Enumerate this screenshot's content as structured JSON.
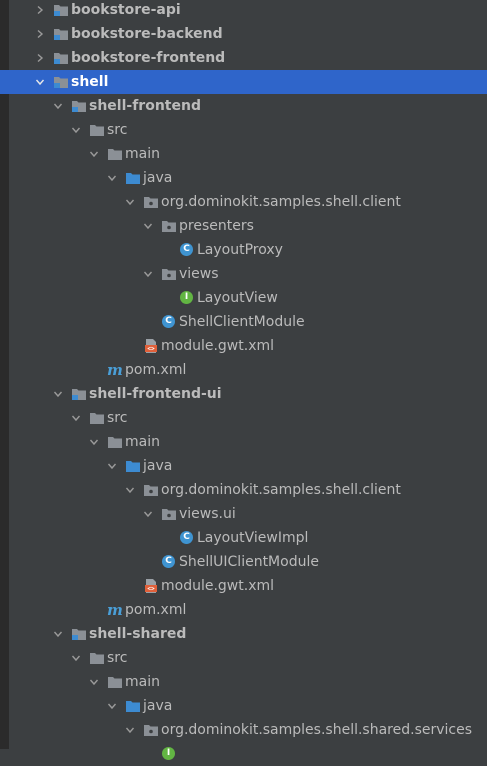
{
  "colors": {
    "background": "#3c3f41",
    "selection": "#2f65ca",
    "folder": "#8b9096",
    "source_folder": "#3d8bd1",
    "class_icon": "#3f94d1",
    "interface_icon": "#62b543",
    "maven": "#4a9fd8"
  },
  "tree": [
    {
      "label": "bookstore-api",
      "depth": 0,
      "arrow": "right",
      "icon": "module-folder-icon",
      "bold": true,
      "selected": false
    },
    {
      "label": "bookstore-backend",
      "depth": 0,
      "arrow": "right",
      "icon": "module-folder-icon",
      "bold": true,
      "selected": false
    },
    {
      "label": "bookstore-frontend",
      "depth": 0,
      "arrow": "right",
      "icon": "module-folder-icon",
      "bold": true,
      "selected": false
    },
    {
      "label": "shell",
      "depth": 0,
      "arrow": "down",
      "icon": "module-folder-icon",
      "bold": true,
      "selected": true
    },
    {
      "label": "shell-frontend",
      "depth": 1,
      "arrow": "down",
      "icon": "module-folder-icon",
      "bold": true,
      "selected": false
    },
    {
      "label": "src",
      "depth": 2,
      "arrow": "down",
      "icon": "folder-icon",
      "bold": false,
      "selected": false
    },
    {
      "label": "main",
      "depth": 3,
      "arrow": "down",
      "icon": "folder-icon",
      "bold": false,
      "selected": false
    },
    {
      "label": "java",
      "depth": 4,
      "arrow": "down",
      "icon": "source-folder-icon",
      "bold": false,
      "selected": false
    },
    {
      "label": "org.dominokit.samples.shell.client",
      "depth": 5,
      "arrow": "down",
      "icon": "package-icon",
      "bold": false,
      "selected": false
    },
    {
      "label": "presenters",
      "depth": 6,
      "arrow": "down",
      "icon": "package-icon",
      "bold": false,
      "selected": false
    },
    {
      "label": "LayoutProxy",
      "depth": 7,
      "arrow": "none",
      "icon": "class-icon",
      "bold": false,
      "selected": false
    },
    {
      "label": "views",
      "depth": 6,
      "arrow": "down",
      "icon": "package-icon",
      "bold": false,
      "selected": false
    },
    {
      "label": "LayoutView",
      "depth": 7,
      "arrow": "none",
      "icon": "interface-icon",
      "bold": false,
      "selected": false
    },
    {
      "label": "ShellClientModule",
      "depth": 6,
      "arrow": "none",
      "icon": "class-icon",
      "bold": false,
      "selected": false
    },
    {
      "label": "module.gwt.xml",
      "depth": 5,
      "arrow": "none",
      "icon": "xml-file-icon",
      "bold": false,
      "selected": false
    },
    {
      "label": "pom.xml",
      "depth": 3,
      "arrow": "none",
      "icon": "maven-icon",
      "bold": false,
      "selected": false
    },
    {
      "label": "shell-frontend-ui",
      "depth": 1,
      "arrow": "down",
      "icon": "module-folder-icon",
      "bold": true,
      "selected": false
    },
    {
      "label": "src",
      "depth": 2,
      "arrow": "down",
      "icon": "folder-icon",
      "bold": false,
      "selected": false
    },
    {
      "label": "main",
      "depth": 3,
      "arrow": "down",
      "icon": "folder-icon",
      "bold": false,
      "selected": false
    },
    {
      "label": "java",
      "depth": 4,
      "arrow": "down",
      "icon": "source-folder-icon",
      "bold": false,
      "selected": false
    },
    {
      "label": "org.dominokit.samples.shell.client",
      "depth": 5,
      "arrow": "down",
      "icon": "package-icon",
      "bold": false,
      "selected": false
    },
    {
      "label": "views.ui",
      "depth": 6,
      "arrow": "down",
      "icon": "package-icon",
      "bold": false,
      "selected": false
    },
    {
      "label": "LayoutViewImpl",
      "depth": 7,
      "arrow": "none",
      "icon": "class-icon",
      "bold": false,
      "selected": false
    },
    {
      "label": "ShellUIClientModule",
      "depth": 6,
      "arrow": "none",
      "icon": "class-icon",
      "bold": false,
      "selected": false
    },
    {
      "label": "module.gwt.xml",
      "depth": 5,
      "arrow": "none",
      "icon": "xml-file-icon",
      "bold": false,
      "selected": false
    },
    {
      "label": "pom.xml",
      "depth": 3,
      "arrow": "none",
      "icon": "maven-icon",
      "bold": false,
      "selected": false
    },
    {
      "label": "shell-shared",
      "depth": 1,
      "arrow": "down",
      "icon": "module-folder-icon",
      "bold": true,
      "selected": false
    },
    {
      "label": "src",
      "depth": 2,
      "arrow": "down",
      "icon": "folder-icon",
      "bold": false,
      "selected": false
    },
    {
      "label": "main",
      "depth": 3,
      "arrow": "down",
      "icon": "folder-icon",
      "bold": false,
      "selected": false
    },
    {
      "label": "java",
      "depth": 4,
      "arrow": "down",
      "icon": "source-folder-icon",
      "bold": false,
      "selected": false
    },
    {
      "label": "org.dominokit.samples.shell.shared.services",
      "depth": 5,
      "arrow": "down",
      "icon": "package-icon",
      "bold": false,
      "selected": false
    },
    {
      "label": "",
      "depth": 6,
      "arrow": "none",
      "icon": "interface-icon",
      "bold": false,
      "selected": false
    }
  ]
}
